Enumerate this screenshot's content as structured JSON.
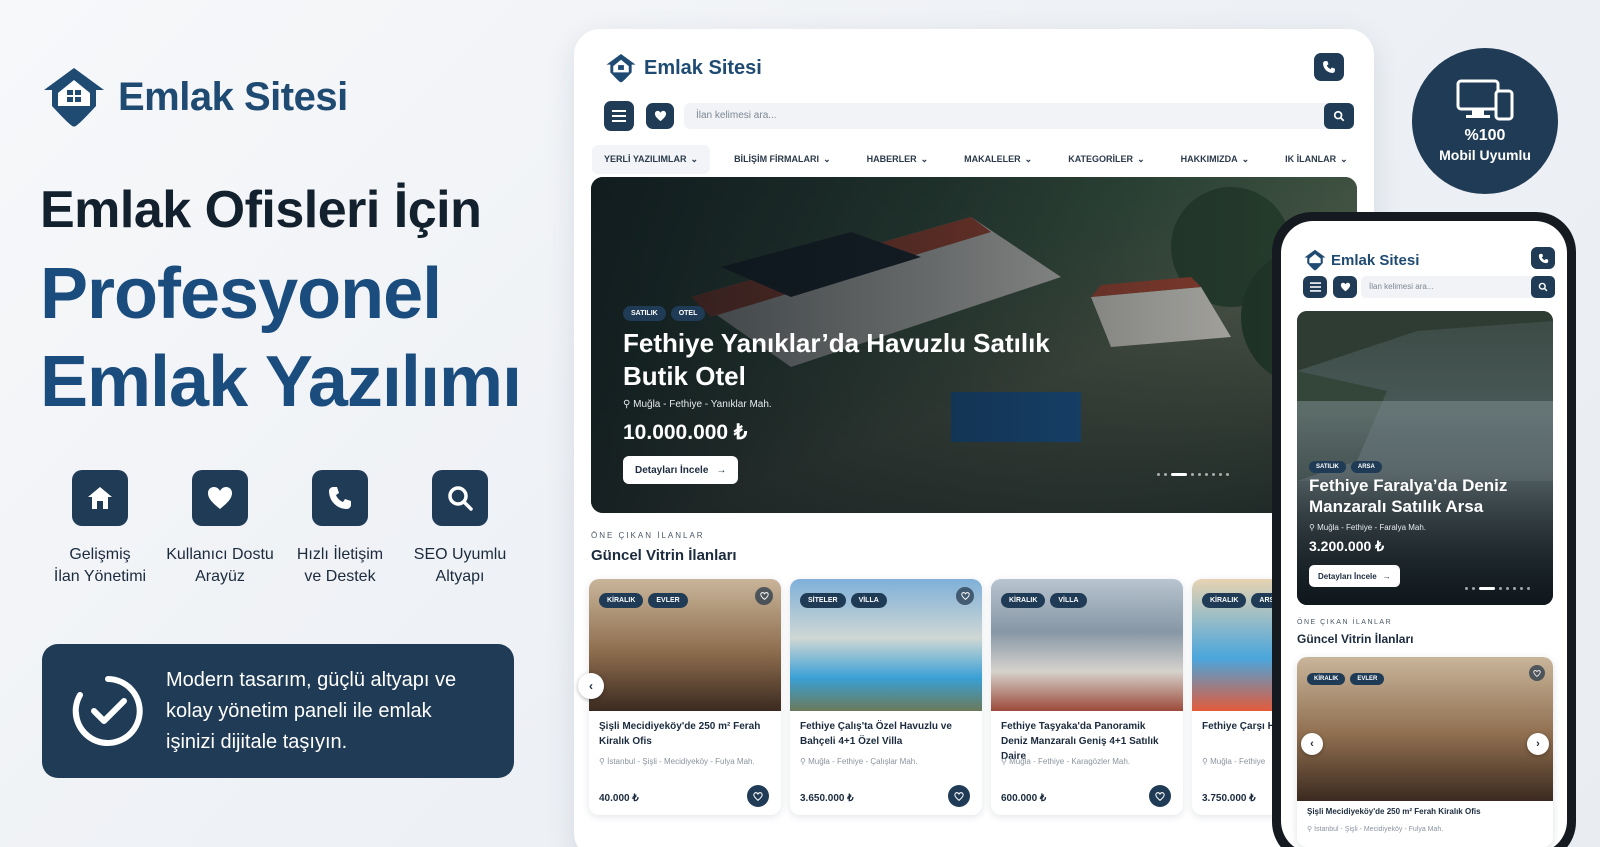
{
  "brand": {
    "name": "Emlak Sitesi"
  },
  "headline": {
    "line1": "Emlak Ofisleri İçin",
    "line2a": "Profesyonel",
    "line2b": "Emlak Yazılımı"
  },
  "features": [
    {
      "icon": "home-icon",
      "label": "Gelişmiş\nİlan Yönetimi"
    },
    {
      "icon": "heart-icon",
      "label": "Kullanıcı Dostu\nArayüz"
    },
    {
      "icon": "phone-icon",
      "label": "Hızlı İletişim\nve Destek"
    },
    {
      "icon": "search-icon",
      "label": "SEO Uyumlu\nAltyapı"
    }
  ],
  "promo": {
    "text": "Modern tasarım, güçlü altyapı ve kolay yönetim paneli ile emlak işinizi dijitale taşıyın."
  },
  "mobile_badge": {
    "percent": "%100",
    "label": "Mobil Uyumlu"
  },
  "desktop": {
    "logo": "Emlak Sitesi",
    "search_placeholder": "İlan kelimesi ara...",
    "menu": [
      "YERLİ YAZILIMLAR",
      "BİLİŞİM FİRMALARI",
      "HABERLER",
      "MAKALELER",
      "KATEGORİLER",
      "HAKKIMIZDA",
      "IK İLANLAR"
    ],
    "hero": {
      "tags": [
        "SATILIK",
        "OTEL"
      ],
      "title": "Fethiye Yanıklar’da Havuzlu Satılık Butik Otel",
      "location": "Muğla - Fethiye - Yanıklar Mah.",
      "price": "10.000.000 ₺",
      "cta": "Detayları İncele"
    },
    "section_kicker": "ÖNE ÇIKAN İLANLAR",
    "section_title": "Güncel Vitrin İlanları",
    "cards": [
      {
        "tags": [
          "KİRALIK",
          "EVLER"
        ],
        "title": "Şişli Mecidiyeköy'de 250 m² Ferah Kiralık Ofis",
        "location": "İstanbul - Şişli - Mecidiyeköy - Fulya Mah.",
        "price": "40.000 ₺"
      },
      {
        "tags": [
          "SİTELER",
          "VİLLA"
        ],
        "title": "Fethiye Çalış'ta Özel Havuzlu ve Bahçeli 4+1 Özel Villa",
        "location": "Muğla - Fethiye - Çalışlar Mah.",
        "price": "3.650.000 ₺"
      },
      {
        "tags": [
          "KİRALIK",
          "VİLLA"
        ],
        "title": "Fethiye Taşyaka'da Panoramik Deniz Manzaralı Geniş 4+1 Satılık Daire",
        "location": "Muğla - Fethiye - Karagözler Mah.",
        "price": "600.000 ₺"
      },
      {
        "tags": [
          "KİRALIK",
          "ARSA"
        ],
        "title": "Fethiye Çarşı Haralu Villa",
        "location": "Muğla - Fethiye",
        "price": "3.750.000 ₺"
      }
    ]
  },
  "phone": {
    "logo": "Emlak Sitesi",
    "search_placeholder": "İlan kelimesi ara...",
    "hero": {
      "tags": [
        "SATILIK",
        "ARSA"
      ],
      "title": "Fethiye Faralya’da Deniz Manzaralı Satılık Arsa",
      "location": "Muğla - Fethiye - Faralya Mah.",
      "price": "3.200.000 ₺",
      "cta": "Detayları İncele"
    },
    "section_kicker": "ÖNE ÇIKAN İLANLAR",
    "section_title": "Güncel Vitrin İlanları",
    "card": {
      "tags": [
        "KİRALIK",
        "EVLER"
      ],
      "title": "Şişli Mecidiyeköy'de 250 m² Ferah Kiralık Ofis",
      "location": "İstanbul - Şişli - Mecidiyeköy - Fulya Mah."
    }
  },
  "colors": {
    "navy": "#1f3b55",
    "brand_blue": "#1f4b73",
    "headline_blue": "#1a4c7e"
  }
}
